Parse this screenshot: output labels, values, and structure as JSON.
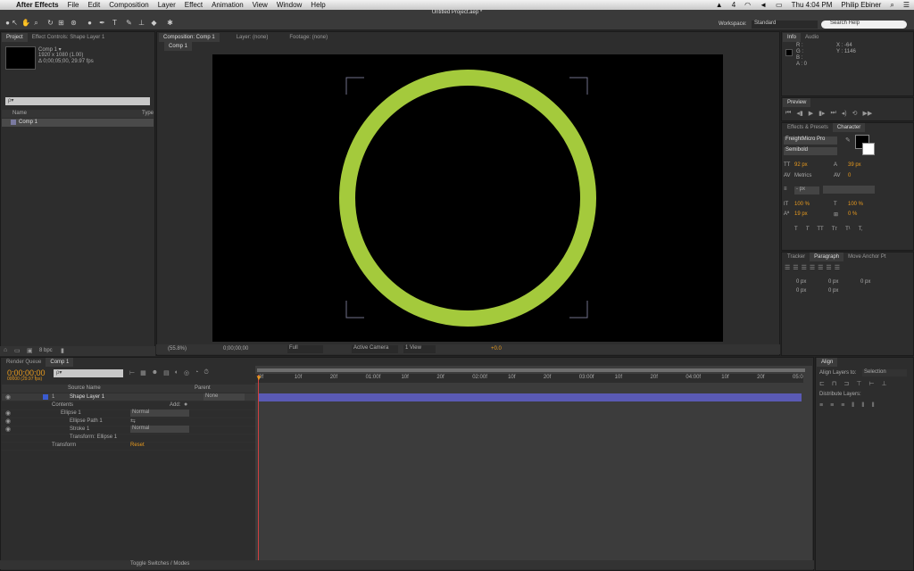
{
  "menubar": {
    "apple": "",
    "app": "After Effects",
    "items": [
      "File",
      "Edit",
      "Composition",
      "Layer",
      "Effect",
      "Animation",
      "View",
      "Window",
      "Help"
    ],
    "status": {
      "badge": "4",
      "clock": "Thu 4:04 PM",
      "user": "Philip Ebiner"
    }
  },
  "titlebar": {
    "title": "Untitled Project.aep *"
  },
  "toolbar": {
    "workspace_label": "Workspace:",
    "workspace_value": "Standard",
    "search_help": "Search Help"
  },
  "project": {
    "tabs": [
      "Project",
      "Effect Controls: Shape Layer 1"
    ],
    "comp_name": "Comp 1 ▾",
    "comp_size": "1920 x 1080 (1.00)",
    "comp_duration": "Δ 0;00;05;00, 29.97 fps",
    "search_placeholder": "ρ▾",
    "col_name": "Name",
    "col_type": "Type",
    "item": "Comp 1",
    "bpc": "8 bpc"
  },
  "comp_viewer": {
    "tabs": [
      "Composition: Comp 1",
      "Layer: (none)",
      "Footage: (none)"
    ],
    "sub_tab": "Comp 1",
    "zoom": "(55.8%)",
    "timecode": "0;00;00;00",
    "resolution": "Full",
    "camera": "Active Camera",
    "views": "1 View",
    "exposure": "+0.0",
    "ring_color": "#a4ca3c"
  },
  "info": {
    "tabs": [
      "Info",
      "Audio"
    ],
    "channels": [
      "R :",
      "G :",
      "B :",
      "A : 0"
    ],
    "x": "X : -64",
    "y": "Y : 1146"
  },
  "preview": {
    "tab": "Preview"
  },
  "character": {
    "tabs": [
      "Effects & Presets",
      "Character"
    ],
    "font": "FreightMicro Pro",
    "style": "Semibold",
    "size": "92 px",
    "leading": "39 px",
    "kerning": "Metrics",
    "tracking": "0",
    "stroke": "- px",
    "vscale": "100 %",
    "hscale": "100 %",
    "baseline": "19 px",
    "tsume": "0 %",
    "styles": [
      "T",
      "T",
      "TT",
      "Tт",
      "T¹",
      "T,"
    ]
  },
  "paragraph": {
    "tabs": [
      "Tracker",
      "Paragraph",
      "Move Anchor Pt"
    ],
    "values": [
      "0 px",
      "0 px",
      "0 px",
      "0 px",
      "0 px"
    ]
  },
  "timeline": {
    "tabs": [
      "Render Queue",
      "Comp 1"
    ],
    "timecode": "0;00;00;00",
    "fps": "00000 (29.97 fps)",
    "search_placeholder": "ρ▾",
    "col_source": "Source Name",
    "col_parent": "Parent",
    "layer_num": "1",
    "layer_name": "Shape Layer 1",
    "parent_value": "None",
    "contents": "Contents",
    "add": "Add:",
    "ellipse": "Ellipse 1",
    "ellipse_mode": "Normal",
    "ellipse_path": "Ellipse Path 1",
    "stroke": "Stroke 1",
    "stroke_mode": "Normal",
    "transform_ellipse": "Transform: Ellipse 1",
    "transform": "Transform",
    "reset": "Reset",
    "ruler": [
      "0f",
      "10f",
      "20f",
      "01:00f",
      "10f",
      "20f",
      "02:00f",
      "10f",
      "20f",
      "03:00f",
      "10f",
      "20f",
      "04:00f",
      "10f",
      "20f",
      "05:0"
    ],
    "toggle": "Toggle Switches / Modes"
  },
  "align": {
    "tab": "Align",
    "align_to_label": "Align Layers to:",
    "align_to_value": "Selection",
    "distribute": "Distribute Layers:"
  }
}
